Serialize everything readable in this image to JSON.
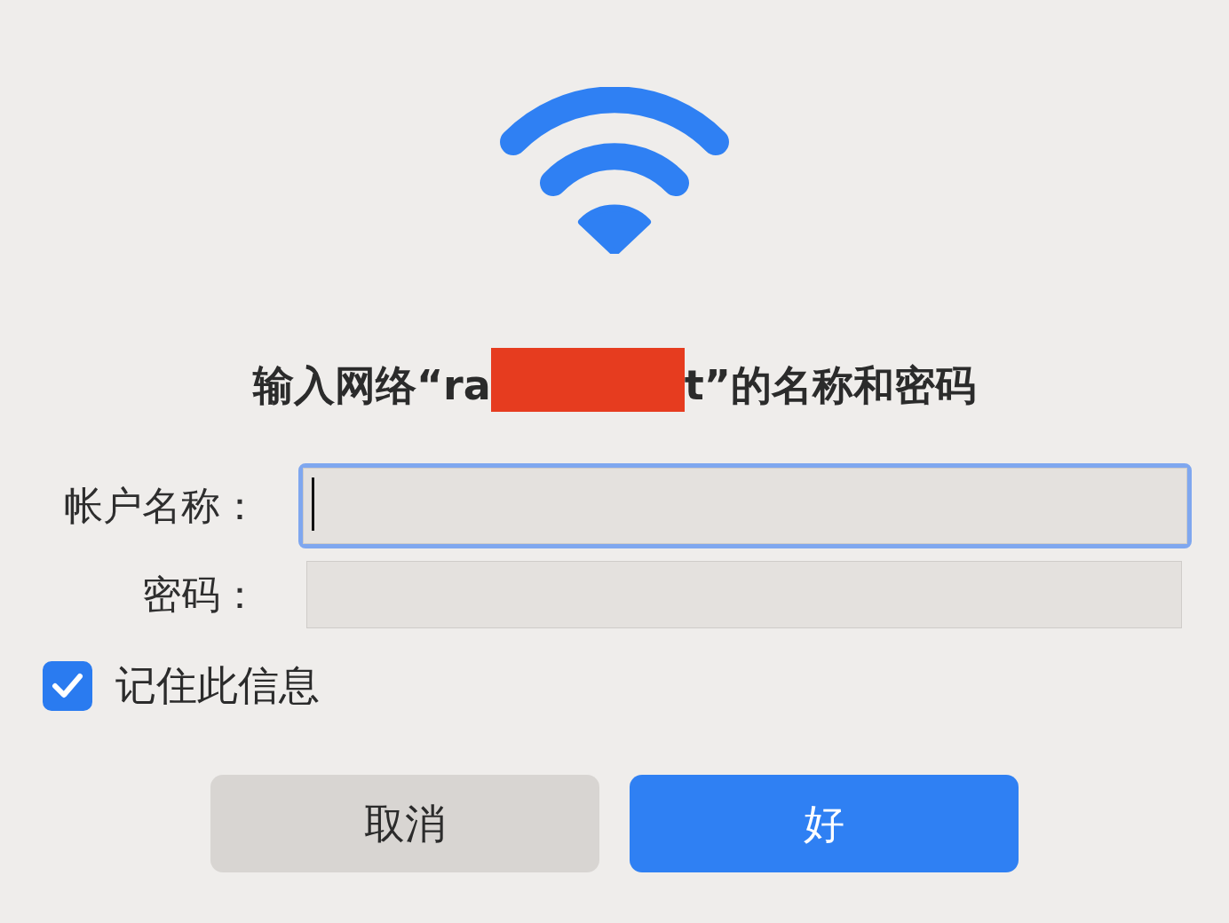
{
  "title": {
    "before": "输入网络“ra",
    "redacted": true,
    "after": "t”的名称和密码"
  },
  "fields": [
    {
      "label": "帐户名称：",
      "focused": true
    },
    {
      "label": "密码：",
      "focused": false
    }
  ],
  "remember": {
    "label": "记住此信息",
    "checked": true
  },
  "buttons": [
    {
      "label": "取消",
      "kind": "secondary"
    },
    {
      "label": "好",
      "kind": "primary"
    }
  ]
}
